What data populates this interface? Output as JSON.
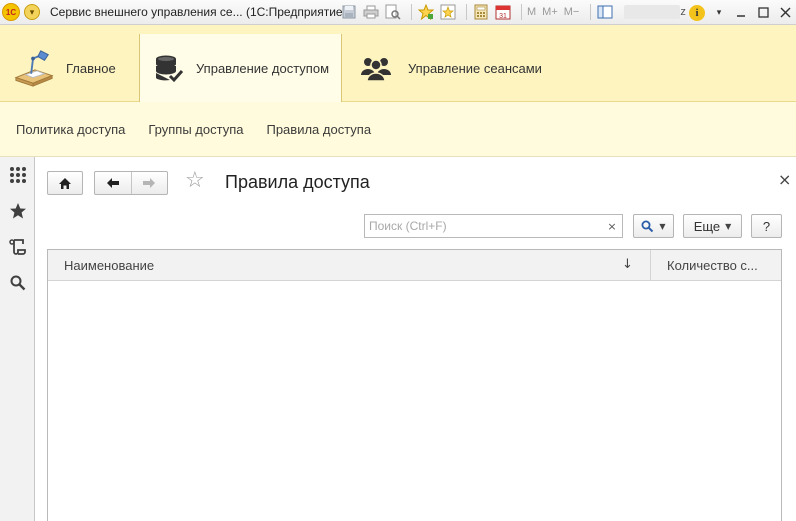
{
  "titlebar": {
    "title": "Сервис внешнего управления се...  (1С:Предприятие)",
    "logo_text": "1С",
    "user_tail": "z",
    "icons": [
      "save-icon",
      "print-icon",
      "preview-icon",
      "favorites-add-icon",
      "favorites-icon",
      "calculator-icon",
      "calendar-icon",
      "memory-m-icon",
      "memory-plus-icon",
      "memory-minus-icon",
      "panel-icon"
    ],
    "memory_labels": {
      "m": "M",
      "mplus": "M+",
      "mminus": "M−"
    },
    "calendar_label": "31",
    "info_label": "i"
  },
  "sections": [
    {
      "label": "Главное",
      "icon": "desk-lamp-icon",
      "active": false
    },
    {
      "label": "Управление доступом",
      "icon": "database-check-icon",
      "active": true
    },
    {
      "label": "Управление сеансами",
      "icon": "users-icon",
      "active": false
    }
  ],
  "functions": [
    "Политика доступа",
    "Группы доступа",
    "Правила доступа"
  ],
  "left_toolbar": [
    "apps-grid-icon",
    "star-icon",
    "history-icon",
    "search-icon"
  ],
  "form": {
    "title": "Правила доступа",
    "close_label": "×",
    "search_placeholder": "Поиск (Ctrl+F)",
    "search_clear": "×",
    "more_label": "Еще",
    "help_label": "?",
    "columns": [
      "Наименование",
      "Количество с..."
    ],
    "sort_indicator": "↓",
    "rows": []
  },
  "colors": {
    "sections_bg": "#fdf4c0",
    "functions_bg": "#fffbdc",
    "toolbar_bg": "#f2f2f2"
  }
}
